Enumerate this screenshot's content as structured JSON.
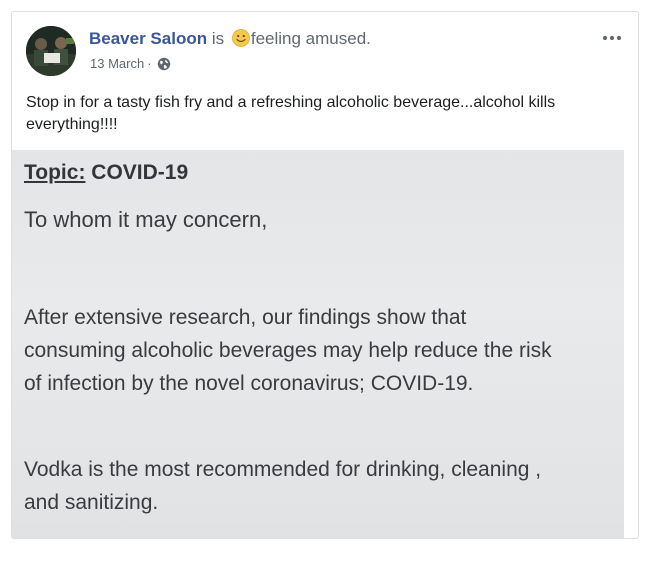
{
  "post": {
    "page_name": "Beaver Saloon",
    "is_word": "is",
    "feeling_icon": "smiling-emoji",
    "feeling_text": "feeling amused.",
    "date": "13 March",
    "separator": "·",
    "privacy_icon": "globe-icon",
    "more_icon": "more-options-icon",
    "text": "Stop in for a tasty fish fry and a refreshing alcoholic beverage...alcohol kills everything!!!!"
  },
  "photo": {
    "topic_label": "Topic:",
    "topic_value": "COVID-19",
    "greeting": "To whom it may concern,",
    "para1_line1": "After extensive research, our findings show that",
    "para1_line2": "consuming alcoholic beverages may help reduce the risk",
    "para1_line3": "of infection by the novel coronavirus; COVID-19.",
    "para2_line1": "Vodka is the most recommended for drinking, cleaning ,",
    "para2_line2": "and sanitizing."
  },
  "colors": {
    "page_name": "#385898",
    "secondary_text": "#606770",
    "body_text": "#1c1e21",
    "photo_bg": "#e6e7e9"
  }
}
